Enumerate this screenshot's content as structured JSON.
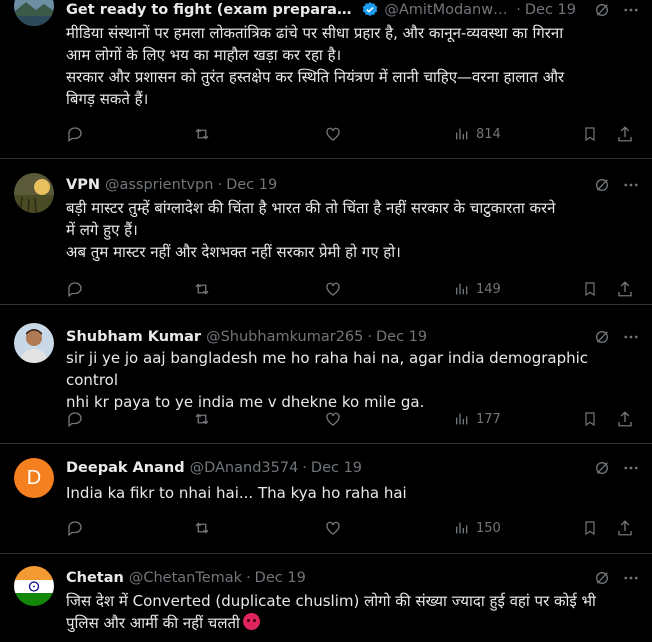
{
  "posts": [
    {
      "name": "Get ready to fight (exam preparati...",
      "handle": "@AmitModanwa...",
      "date": "Dec 19",
      "verified": true,
      "lines": [
        "मीडिया संस्थानों पर हमला लोकतांत्रिक ढांचे पर सीधा प्रहार है, और कानून-व्यवस्था का गिरना",
        "आम लोगों के लिए भय का माहौल खड़ा कर रहा है।",
        "सरकार और प्रशासन को तुरंत हस्तक्षेप कर स्थिति नियंत्रण में लानी चाहिए—वरना हालात और",
        "बिगड़ सकते हैं।"
      ],
      "views": "814",
      "avatar_icon": "landscape-avatar-icon"
    },
    {
      "name": "VPN",
      "handle": "@assprientvpn",
      "date": "Dec 19",
      "verified": false,
      "lines": [
        "बड़ी मास्टर तुम्हें बांग्लादेश की चिंता है भारत की तो चिंता है नहीं सरकार के चाटुकारता करने",
        "में लगे हुए हैं।",
        "अब तुम मास्टर नहीं और देशभक्त नहीं सरकार प्रेमी हो गए हो।"
      ],
      "views": "149",
      "avatar_icon": "sunset-field-avatar-icon"
    },
    {
      "name": "Shubham Kumar",
      "handle": "@Shubhamkumar265",
      "date": "Dec 19",
      "verified": false,
      "lines": [
        "sir ji ye jo aaj bangladesh me ho raha hai na, agar india demographic control",
        "nhi kr paya to ye india me v dhekne ko mile ga."
      ],
      "views": "177",
      "avatar_icon": "person-photo-avatar-icon"
    },
    {
      "name": "Deepak Anand",
      "handle": "@DAnand3574",
      "date": "Dec 19",
      "verified": false,
      "lines": [
        "India ka fikr to nhai hai... Tha kya ho raha hai"
      ],
      "views": "150",
      "avatar_letter": "D"
    },
    {
      "name": "Chetan",
      "handle": "@ChetanTemak",
      "date": "Dec 19",
      "verified": false,
      "lines": [
        "जिस देश में Converted (duplicate chuslim) लोगो की संख्या ज्यादा हुई वहां पर कोई भी",
        "पुलिस और आर्मी की नहीं चलती"
      ],
      "emoji": "angry-face-emoji",
      "avatar_icon": "india-flag-avatar-icon"
    }
  ],
  "colors": {
    "background": "#000000",
    "text": "#e7e9ea",
    "muted": "#71767b",
    "divider": "#2f3336",
    "verified": "#1d9bf0"
  }
}
